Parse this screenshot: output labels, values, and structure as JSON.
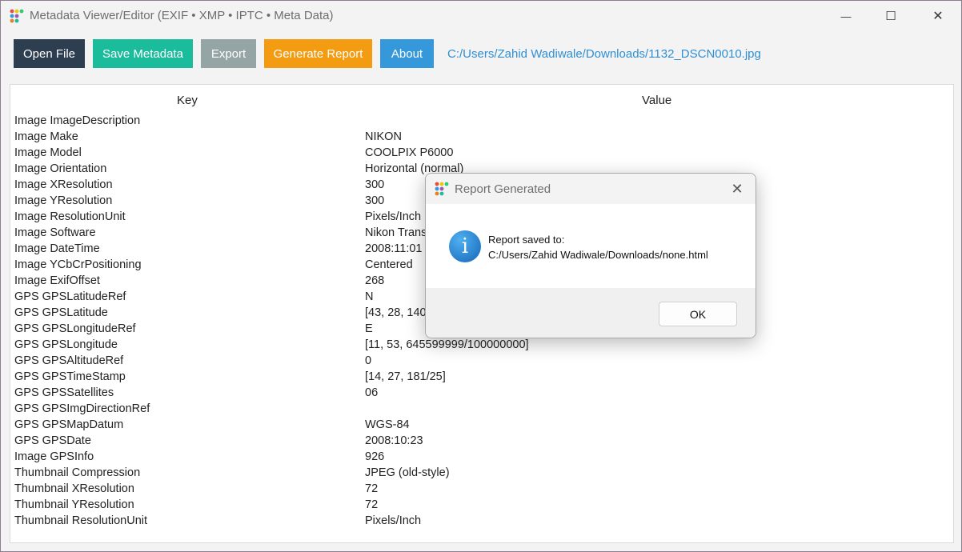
{
  "window": {
    "title": "Metadata Viewer/Editor (EXIF • XMP • IPTC • Meta Data)",
    "controls": {
      "minimize": "—",
      "maximize": "☐",
      "close": "✕"
    }
  },
  "toolbar": {
    "open_file": "Open File",
    "save_metadata": "Save Metadata",
    "export": "Export",
    "generate_report": "Generate Report",
    "about": "About",
    "file_path": "C:/Users/Zahid Wadiwale/Downloads/1132_DSCN0010.jpg",
    "colors": {
      "open_file": "#2c3e50",
      "save_metadata": "#1abc9c",
      "export": "#95a5a6",
      "generate_report": "#f39c12",
      "about": "#3498db"
    }
  },
  "table": {
    "headers": {
      "key": "Key",
      "value": "Value"
    },
    "rows": [
      {
        "key": "Image ImageDescription",
        "value": ""
      },
      {
        "key": "Image Make",
        "value": "NIKON"
      },
      {
        "key": "Image Model",
        "value": "COOLPIX P6000"
      },
      {
        "key": "Image Orientation",
        "value": "Horizontal (normal)"
      },
      {
        "key": "Image XResolution",
        "value": "300"
      },
      {
        "key": "Image YResolution",
        "value": "300"
      },
      {
        "key": "Image ResolutionUnit",
        "value": "Pixels/Inch"
      },
      {
        "key": "Image Software",
        "value": "Nikon Trans"
      },
      {
        "key": "Image DateTime",
        "value": "2008:11:01 2"
      },
      {
        "key": "Image YCbCrPositioning",
        "value": "Centered"
      },
      {
        "key": "Image ExifOffset",
        "value": "268"
      },
      {
        "key": "GPS GPSLatitudeRef",
        "value": "N"
      },
      {
        "key": "GPS GPSLatitude",
        "value": "[43, 28, 140"
      },
      {
        "key": "GPS GPSLongitudeRef",
        "value": "E"
      },
      {
        "key": "GPS GPSLongitude",
        "value": "[11, 53, 645599999/100000000]"
      },
      {
        "key": "GPS GPSAltitudeRef",
        "value": "0"
      },
      {
        "key": "GPS GPSTimeStamp",
        "value": "[14, 27, 181/25]"
      },
      {
        "key": "GPS GPSSatellites",
        "value": "06"
      },
      {
        "key": "GPS GPSImgDirectionRef",
        "value": ""
      },
      {
        "key": "GPS GPSMapDatum",
        "value": "WGS-84"
      },
      {
        "key": "GPS GPSDate",
        "value": "2008:10:23"
      },
      {
        "key": "Image GPSInfo",
        "value": "926"
      },
      {
        "key": "Thumbnail Compression",
        "value": "JPEG (old-style)"
      },
      {
        "key": "Thumbnail XResolution",
        "value": "72"
      },
      {
        "key": "Thumbnail YResolution",
        "value": "72"
      },
      {
        "key": "Thumbnail ResolutionUnit",
        "value": "Pixels/Inch"
      }
    ]
  },
  "dialog": {
    "title": "Report Generated",
    "icon": "info-icon",
    "message_line1": "Report saved to:",
    "message_line2": "C:/Users/Zahid Wadiwale/Downloads/none.html",
    "ok": "OK"
  }
}
